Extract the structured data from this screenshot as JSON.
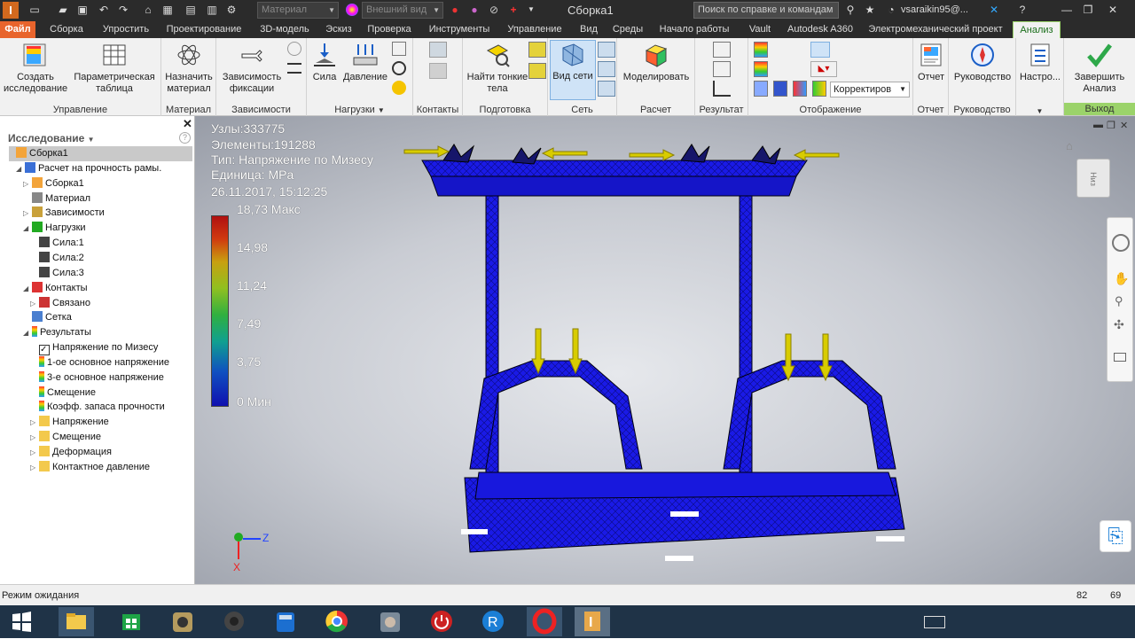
{
  "titlebar": {
    "style_combo": "Материал",
    "appearance_combo": "Внешний вид",
    "app_title": "Сборка1",
    "search_placeholder": "Поиск по справке и командам",
    "user": "vsaraikin95@..."
  },
  "menu": {
    "tabs": [
      "Файл",
      "Сборка",
      "Упростить",
      "Проектирование",
      "3D-модель",
      "Эскиз",
      "Проверка",
      "Инструменты",
      "Управление",
      "Вид",
      "Среды",
      "Начало работы",
      "Vault",
      "Autodesk A360",
      "Электромеханический проект",
      "Анализ"
    ],
    "active_tab": "Анализ",
    "file_tab": "Файл"
  },
  "ribbon": {
    "create_study": "Создать исследование",
    "param_table": "Параметрическая таблица",
    "assign_material": "Назначить материал",
    "fixed_constraint": "Зависимость фиксации",
    "force": "Сила",
    "pressure": "Давление",
    "find_thin": "Найти тонкие тела",
    "mesh_view": "Вид сети",
    "simulate": "Моделировать",
    "report": "Отчет",
    "guide": "Руководство",
    "settings": "Настро...",
    "finish_analysis": "Завершить Анализ",
    "display_combo": "Корректиров",
    "groups": {
      "manage": "Управление",
      "material": "Материал",
      "constraints": "Зависимости",
      "loads": "Нагрузки",
      "contacts": "Контакты",
      "prepare": "Подготовка",
      "mesh": "Сеть",
      "solve": "Расчет",
      "result": "Результат",
      "display": "Отображение",
      "report": "Отчет",
      "guide": "Руководство",
      "exit": "Выход"
    }
  },
  "browser": {
    "header": "Исследование",
    "tree": [
      {
        "label": "Сборка1",
        "level": 0,
        "expander": "",
        "selected": true,
        "icon": "assembly-icon"
      },
      {
        "label": "Расчет на прочность рамы.",
        "level": 1,
        "expander": "open",
        "icon": "study-icon"
      },
      {
        "label": "Сборка1",
        "level": 2,
        "expander": "closed",
        "icon": "assembly-icon"
      },
      {
        "label": "Материал",
        "level": 2,
        "expander": "",
        "icon": "material-icon"
      },
      {
        "label": "Зависимости",
        "level": 2,
        "expander": "closed",
        "icon": "constraints-icon"
      },
      {
        "label": "Нагрузки",
        "level": 2,
        "expander": "open",
        "icon": "loads-icon"
      },
      {
        "label": "Сила:1",
        "level": 3,
        "expander": "",
        "icon": "force-icon"
      },
      {
        "label": "Сила:2",
        "level": 3,
        "expander": "",
        "icon": "force-icon"
      },
      {
        "label": "Сила:3",
        "level": 3,
        "expander": "",
        "icon": "force-icon"
      },
      {
        "label": "Контакты",
        "level": 2,
        "expander": "open",
        "icon": "contacts-icon"
      },
      {
        "label": "Связано",
        "level": 3,
        "expander": "closed",
        "icon": "bonded-icon"
      },
      {
        "label": "Сетка",
        "level": 2,
        "expander": "",
        "icon": "mesh-icon"
      },
      {
        "label": "Результаты",
        "level": 2,
        "expander": "open",
        "icon": "results-icon"
      },
      {
        "label": "Напряжение по Мизесу",
        "level": 3,
        "expander": "",
        "icon": "checked-result-icon"
      },
      {
        "label": "1-ое основное напряжение",
        "level": 3,
        "expander": "",
        "icon": "result-icon"
      },
      {
        "label": "3-е основное напряжение",
        "level": 3,
        "expander": "",
        "icon": "result-icon"
      },
      {
        "label": "Смещение",
        "level": 3,
        "expander": "",
        "icon": "result-icon"
      },
      {
        "label": "Коэфф. запаса прочности",
        "level": 3,
        "expander": "",
        "icon": "result-icon"
      },
      {
        "label": "Напряжение",
        "level": 3,
        "expander": "closed",
        "icon": "folder-icon"
      },
      {
        "label": "Смещение",
        "level": 3,
        "expander": "closed",
        "icon": "folder-icon"
      },
      {
        "label": "Деформация",
        "level": 3,
        "expander": "closed",
        "icon": "folder-icon"
      },
      {
        "label": "Контактное давление",
        "level": 3,
        "expander": "closed",
        "icon": "folder-icon"
      }
    ]
  },
  "viewport": {
    "nodes": "Узлы:333775",
    "elements": "Элементы:191288",
    "type": "Тип: Напряжение по Мизесу",
    "unit": "Единица: MPa",
    "datetime": "26.11.2017, 15:12:25",
    "legend": [
      "18,73 Макс",
      "14,98",
      "11,24",
      "7,49",
      "3,75",
      "0 Мин"
    ],
    "axis_z": "Z",
    "axis_x": "X",
    "viewcube_label": "Низ",
    "colors": {
      "mesh": "#1a1ae6",
      "arrows": "#d4c800"
    }
  },
  "status": {
    "text": "Режим ожидания",
    "num1": "82",
    "num2": "69"
  }
}
